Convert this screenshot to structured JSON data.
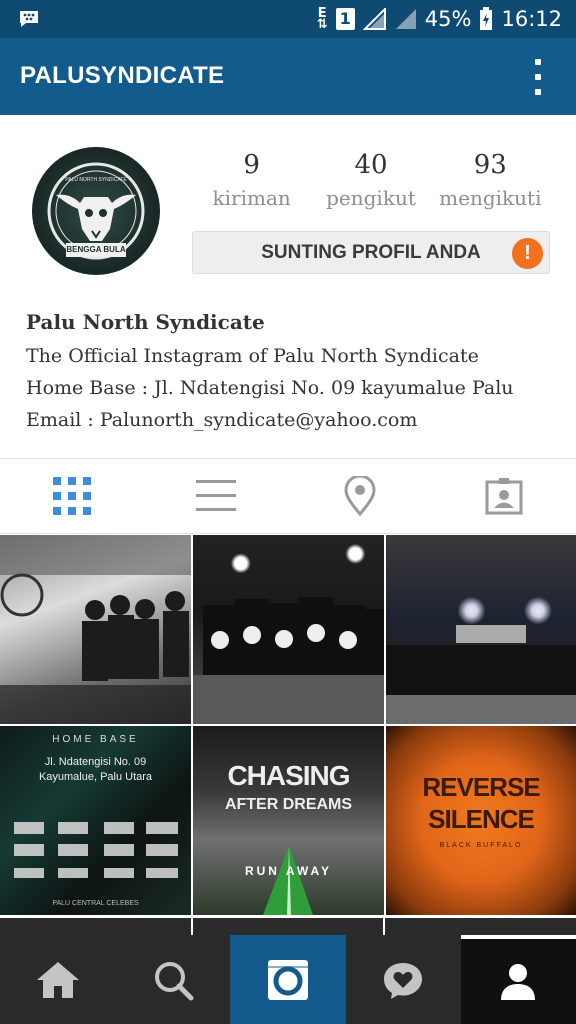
{
  "status_bar": {
    "network_type": "E",
    "sim_slot": "1",
    "battery": "45%",
    "time": "16:12"
  },
  "app_bar": {
    "title": "PALUSYNDICATE"
  },
  "profile": {
    "avatar_text_top": "PALU NORTH SYNDICATE",
    "avatar_text_bottom": "BENGGA BULA",
    "stats": [
      {
        "value": "9",
        "label": "kiriman"
      },
      {
        "value": "40",
        "label": "pengikut"
      },
      {
        "value": "93",
        "label": "mengikuti"
      }
    ],
    "edit_button_label": "SUNTING PROFIL ANDA",
    "warning_mark": "!",
    "name": "Palu North Syndicate",
    "bio_lines": [
      "The Official Instagram of Palu North Syndicate",
      "Home Base : Jl. Ndatengisi No. 09 kayumalue Palu",
      "Email : Palunorth_syndicate@yahoo.com"
    ]
  },
  "tabs": [
    {
      "icon": "grid-icon",
      "active": true
    },
    {
      "icon": "list-icon",
      "active": false
    },
    {
      "icon": "location-pin-icon",
      "active": false
    },
    {
      "icon": "tagged-photos-icon",
      "active": false
    }
  ],
  "posts": {
    "home_base": {
      "header": "HOME BASE",
      "address_line1": "Jl. Ndatengisi No. 09",
      "address_line2": "Kayumalue, Palu Utara",
      "footer": "PALU CENTRAL CELEBES"
    },
    "chasing": {
      "title_line1": "CHASING",
      "title_line2": "AFTER DREAMS",
      "subtitle": "RUN AWAY"
    },
    "reverse": {
      "title_line1": "REVERSE",
      "title_line2": "SILENCE",
      "subtitle": "BLACK BUFFALO"
    }
  },
  "bottom_nav": [
    {
      "icon": "home-icon"
    },
    {
      "icon": "search-icon"
    },
    {
      "icon": "camera-icon"
    },
    {
      "icon": "activity-heart-icon"
    },
    {
      "icon": "profile-icon"
    }
  ],
  "colors": {
    "status_bar": "#0f4a73",
    "app_bar": "#135b8c",
    "active_tab": "#3d8ed7",
    "inactive_tab": "#9a9a9a",
    "warning": "#f37021",
    "bottom_nav": "#2a2a2a"
  }
}
